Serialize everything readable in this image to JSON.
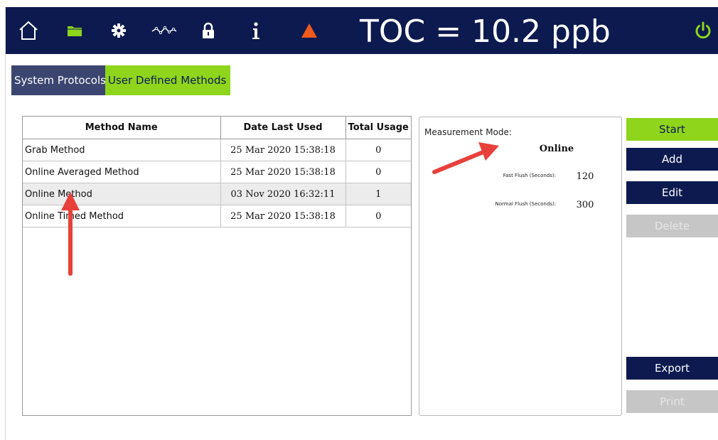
{
  "header": {
    "title": "TOC = 10.2 ppb",
    "icons": [
      "home-icon",
      "folder-icon",
      "gear-icon",
      "trend-icon",
      "lock-icon",
      "info-icon",
      "warning-icon",
      "power-icon"
    ],
    "colors": {
      "bar": "#0d1a4f",
      "folder": "#8ed51c",
      "warning": "#f05a1c",
      "power": "#8ed51c"
    }
  },
  "tabs": [
    {
      "label": "System Protocols"
    },
    {
      "label": "User Defined Methods"
    }
  ],
  "methods_table": {
    "columns": [
      "Method Name",
      "Date Last Used",
      "Total Usage"
    ],
    "rows": [
      {
        "name": "Grab Method",
        "date": "25 Mar 2020 15:38:18",
        "usage": "0"
      },
      {
        "name": "Online Averaged Method",
        "date": "25 Mar 2020 15:38:18",
        "usage": "0"
      },
      {
        "name": "Online Method",
        "date": "03 Nov 2020 16:32:11",
        "usage": "1"
      },
      {
        "name": "Online Timed Method",
        "date": "25 Mar 2020 15:38:18",
        "usage": "0"
      }
    ]
  },
  "details": {
    "measurement_mode_label": "Measurement Mode:",
    "measurement_mode_value": "Online",
    "params": [
      {
        "label": "Fast Flush (Seconds):",
        "value": "120"
      },
      {
        "label": "Normal Flush (Seconds):",
        "value": "300"
      }
    ]
  },
  "buttons": {
    "start": "Start",
    "add": "Add",
    "edit": "Edit",
    "delete": "Delete",
    "export": "Export",
    "print": "Print"
  },
  "colors": {
    "accent_green": "#8ed51c",
    "navy": "#0d1a4f",
    "annotation_arrow": "#e8403a"
  }
}
